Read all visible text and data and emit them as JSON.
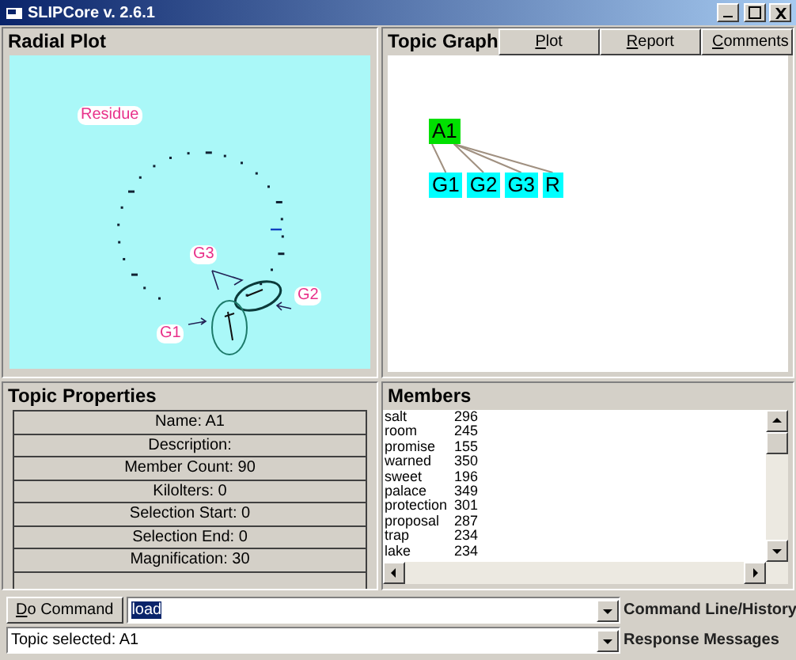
{
  "window": {
    "title": "SLIPCore  v. 2.6.1"
  },
  "radial_plot": {
    "title": "Radial Plot",
    "labels": [
      "Residue",
      "G3",
      "G2",
      "G1"
    ]
  },
  "topic_graph": {
    "title": "Topic Graph",
    "buttons": [
      "Plot",
      "Report",
      "Comments"
    ],
    "root": {
      "label": "A1",
      "selected": true,
      "children": [
        {
          "label": "G1",
          "selected": false
        },
        {
          "label": "G2",
          "selected": false
        },
        {
          "label": "G3",
          "selected": false
        },
        {
          "label": "R",
          "selected": false
        }
      ]
    }
  },
  "topic_properties": {
    "title": "Topic Properties",
    "rows": [
      "Name: A1",
      "Description:",
      "Member Count: 90",
      "Kilolters: 0",
      "Selection Start: 0",
      "Selection End: 0",
      "Magnification: 30"
    ]
  },
  "members": {
    "title": "Members",
    "rows": [
      {
        "word": "salt",
        "count": "296"
      },
      {
        "word": "room",
        "count": "245"
      },
      {
        "word": "promise",
        "count": "155"
      },
      {
        "word": "warned",
        "count": "350"
      },
      {
        "word": "sweet",
        "count": "196"
      },
      {
        "word": "palace",
        "count": "349"
      },
      {
        "word": "protection",
        "count": "301"
      },
      {
        "word": "proposal",
        "count": "287"
      },
      {
        "word": "trap",
        "count": "234"
      },
      {
        "word": "lake",
        "count": "234"
      }
    ]
  },
  "command": {
    "button": "Do Command",
    "value": "load",
    "label": "Command Line/History"
  },
  "response": {
    "value": "Topic selected: A1",
    "label": "Response Messages"
  }
}
